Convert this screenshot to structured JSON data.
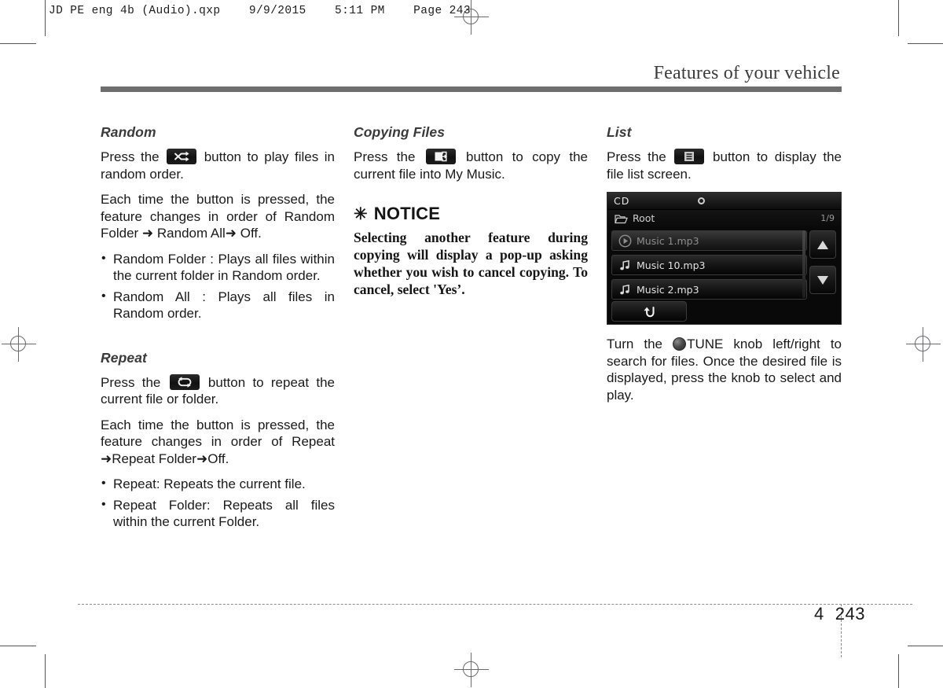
{
  "print_header": "JD PE eng 4b (Audio).qxp    9/9/2015    5:11 PM    Page 243",
  "running_head": "Features of your vehicle",
  "columns": {
    "random": {
      "title": "Random",
      "icon_name": "shuffle-icon",
      "para_1_before": "Press the ",
      "para_1_after": " button to play files in random order.",
      "para_2": "Each time the button is pressed, the feature changes in order of Random Folder ➜ Random All➜ Off.",
      "bullets": [
        "Random Folder : Plays all files within the current folder in Random order.",
        "Random All : Plays all files in Random order."
      ]
    },
    "repeat": {
      "title": "Repeat",
      "icon_name": "repeat-icon",
      "para_1_before": "Press the ",
      "para_1_after": " button to repeat the current file or folder.",
      "para_2": "Each time the button is pressed, the feature changes in order of Repeat ➜Repeat Folder➜Off.",
      "bullets": [
        "Repeat: Repeats the current file.",
        "Repeat Folder: Repeats all files within the current Folder."
      ]
    },
    "copying": {
      "title": "Copying Files",
      "icon_name": "copy-icon",
      "para_1_before": "Press the ",
      "para_1_after": " button to copy the current file into My Music."
    },
    "notice": {
      "star": "✳",
      "title": "NOTICE",
      "body": "Selecting another feature during copying will display a pop-up asking whether you wish to cancel copying. To cancel, select 'Yes’."
    },
    "list": {
      "title": "List",
      "icon_name": "list-icon",
      "para_1_before": "Press the ",
      "para_1_after": " button to display the file list screen.",
      "para_2_before": "Turn the ",
      "para_2_after": "TUNE knob left/right to search for files. Once the desired file is displayed, press the knob to select and play."
    }
  },
  "screen": {
    "source_label": "CD",
    "disc_icon": "disc-icon",
    "breadcrumb_icon": "folder-icon",
    "breadcrumb_label": "Root",
    "page_count": "1/9",
    "rows": [
      {
        "label": "Music 1.mp3",
        "icon": "play-circle-icon",
        "state": "playing"
      },
      {
        "label": "Music 10.mp3",
        "icon": "music-note-icon",
        "state": "normal"
      },
      {
        "label": "Music 2.mp3",
        "icon": "music-note-icon",
        "state": "normal"
      }
    ],
    "scroll_up_icon": "triangle-up-icon",
    "scroll_down_icon": "triangle-down-icon",
    "back_icon": "back-arrow-icon"
  },
  "footer": {
    "chapter": "4",
    "page": "243"
  }
}
